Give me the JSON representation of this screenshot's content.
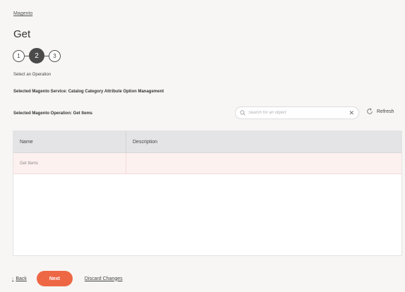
{
  "breadcrumb": "Magento",
  "title": "Get",
  "stepper": {
    "steps": [
      "1",
      "2",
      "3"
    ],
    "active_step": 2
  },
  "subtitle": "Select an Operation",
  "selected_service": "Selected Magento Service: Catalog Category Attribute Option Management",
  "selected_operation": "Selected Magento Operation: Get Items",
  "search": {
    "placeholder": "Search for an object",
    "value": ""
  },
  "refresh_label": "Refresh",
  "table": {
    "columns": [
      "Name",
      "Description"
    ],
    "rows": [
      {
        "name": "Get Items",
        "description": ""
      }
    ]
  },
  "footer": {
    "back_label": "Back",
    "next_label": "Next",
    "discard_label": "Discard Changes"
  },
  "colors": {
    "accent": "#ee6744",
    "selected_row": "#fdf1ef",
    "header_bg": "#e4e4e6",
    "step_active": "#4a4a4a"
  }
}
